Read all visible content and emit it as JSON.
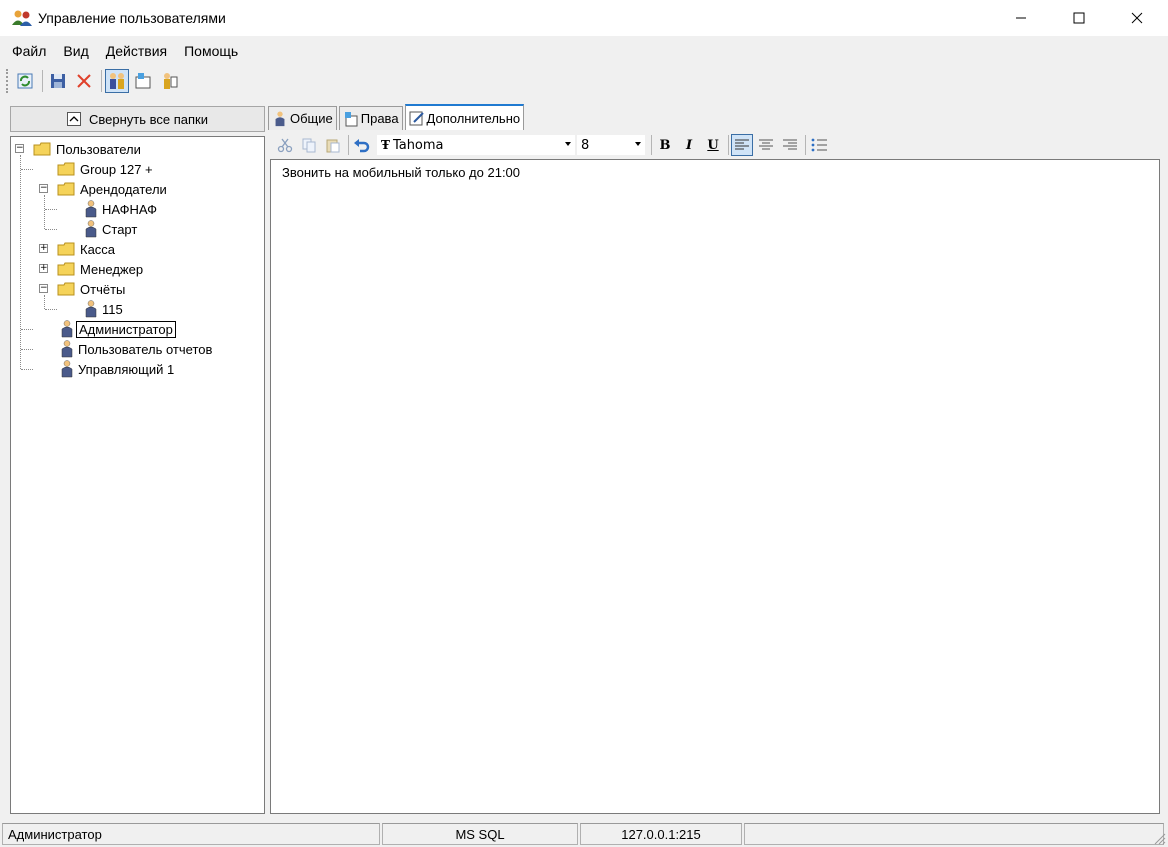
{
  "window": {
    "title": "Управление пользователями"
  },
  "menu": [
    "Файл",
    "Вид",
    "Действия",
    "Помощь"
  ],
  "left_panel": {
    "collapse_label": "Свернуть все папки",
    "tree": {
      "root": "Пользователи",
      "group127": "Group 127 +",
      "arendodateli": "Арендодатели",
      "nafnaf": "НАФНАФ",
      "start": "Старт",
      "kassa": "Касса",
      "menedzher": "Менеджер",
      "otchety": "Отчёты",
      "u115": "115",
      "admin": "Администратор",
      "report_user": "Пользователь отчетов",
      "manager1": "Управляющий 1"
    }
  },
  "tabs": [
    "Общие",
    "Права",
    "Дополнительно"
  ],
  "format_toolbar": {
    "font_name": "Tahoma",
    "font_size": "8",
    "bold": "B",
    "italic": "I",
    "underline": "U"
  },
  "editor": {
    "text": "Звонить на мобильный только до 21:00"
  },
  "statusbar": {
    "user": "Администратор",
    "db": "MS SQL",
    "server": "127.0.0.1:215"
  },
  "colors": {
    "tab_accent": "#1f7ad1",
    "selection": "#cfe3f7",
    "folder": "#f5d35a"
  }
}
